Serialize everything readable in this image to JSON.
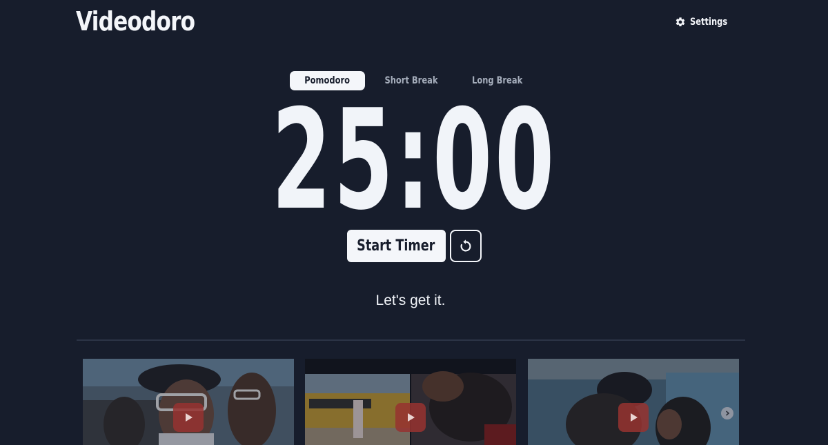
{
  "app": {
    "title": "Videodoro"
  },
  "header": {
    "settings_label": "Settings",
    "settings_icon": "gear-icon"
  },
  "modes": {
    "tabs": [
      {
        "label": "Pomodoro",
        "active": true
      },
      {
        "label": "Short Break",
        "active": false
      },
      {
        "label": "Long Break",
        "active": false
      }
    ]
  },
  "timer": {
    "display": "25:00"
  },
  "controls": {
    "start_label": "Start Timer",
    "reset_icon": "reset-icon"
  },
  "motto": "Let's get it.",
  "videos": {
    "items": [
      {
        "icon": "play-icon"
      },
      {
        "icon": "play-icon"
      },
      {
        "icon": "play-icon"
      }
    ],
    "next_icon": "chevron-right-icon"
  },
  "colors": {
    "background": "#171d2c",
    "foreground": "#f4f6fa",
    "muted": "#a5adbb",
    "play_button": "#963230"
  }
}
